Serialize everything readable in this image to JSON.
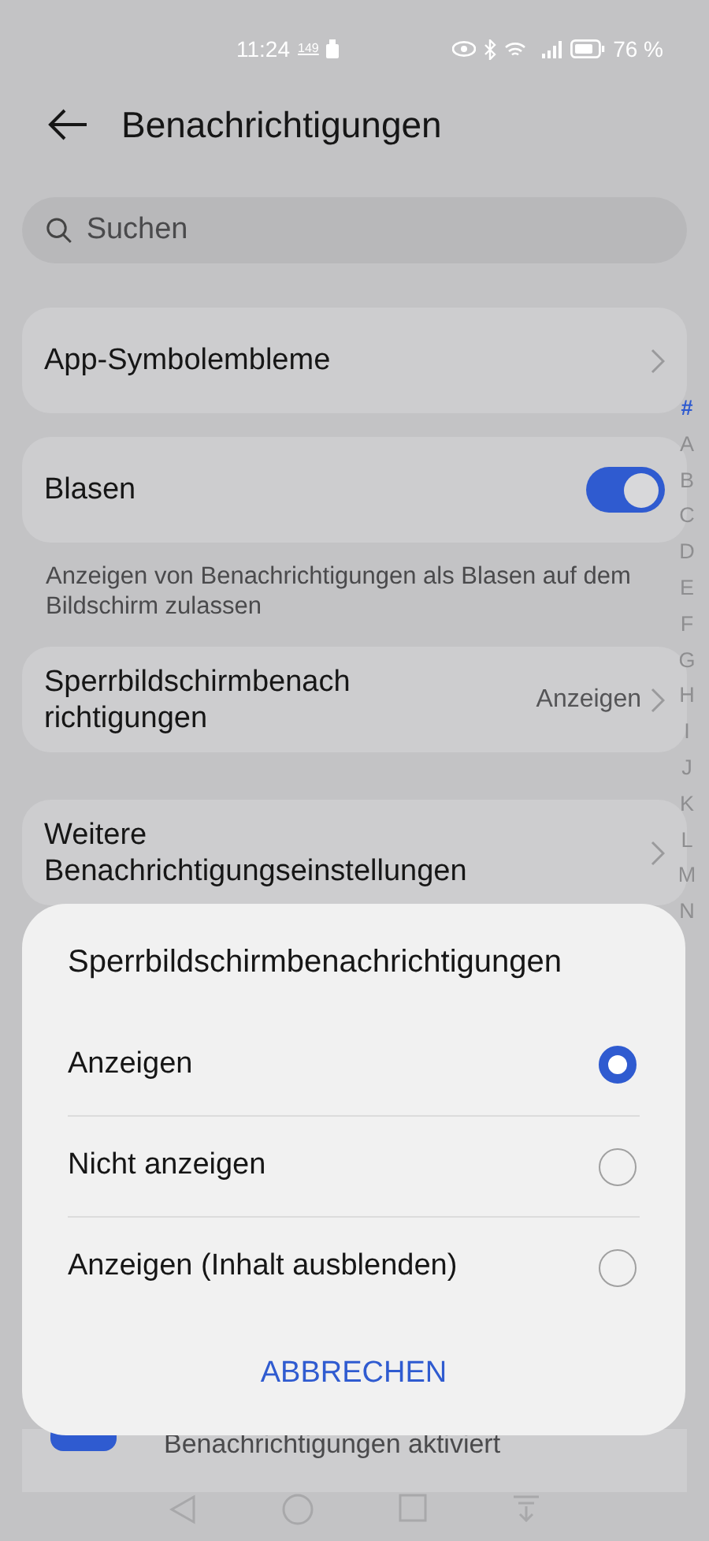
{
  "status_bar": {
    "time": "11:24",
    "badge": "149",
    "battery": "76 %"
  },
  "header": {
    "title": "Benachrichtigungen"
  },
  "search": {
    "placeholder": "Suchen"
  },
  "settings": [
    {
      "kind": "link",
      "label_lines": [
        "App-Symbolembleme"
      ]
    },
    {
      "kind": "toggle",
      "label_lines": [
        "Blasen"
      ],
      "on": true,
      "description": "Anzeigen von Benachrichtigungen als Blasen auf dem Bildschirm zulassen"
    },
    {
      "kind": "link",
      "label_lines": [
        "Sperrbildschirmbenach",
        "richtigungen"
      ],
      "value": "Anzeigen"
    },
    {
      "kind": "link",
      "label_lines": [
        "Weitere",
        "Benachrichtigungseinstellungen"
      ]
    }
  ],
  "partial_row": {
    "label": "Benachrichtigungen aktiviert"
  },
  "index": [
    {
      "label": "#",
      "selected": true
    },
    {
      "label": "A",
      "selected": false
    },
    {
      "label": "B",
      "selected": false
    },
    {
      "label": "C",
      "selected": false
    },
    {
      "label": "D",
      "selected": false
    },
    {
      "label": "E",
      "selected": false
    },
    {
      "label": "F",
      "selected": false
    },
    {
      "label": "G",
      "selected": false
    },
    {
      "label": "H",
      "selected": false
    },
    {
      "label": "I",
      "selected": false
    },
    {
      "label": "J",
      "selected": false
    },
    {
      "label": "K",
      "selected": false
    },
    {
      "label": "L",
      "selected": false
    },
    {
      "label": "M",
      "selected": false
    },
    {
      "label": "N",
      "selected": false
    }
  ],
  "dialog": {
    "title": "Sperrbildschirmbenachrichtigungen",
    "options": [
      {
        "label": "Anzeigen",
        "selected": true
      },
      {
        "label": "Nicht anzeigen",
        "selected": false
      },
      {
        "label": "Anzeigen (Inhalt ausblenden)",
        "selected": false
      }
    ],
    "cancel": "ABBRECHEN"
  }
}
